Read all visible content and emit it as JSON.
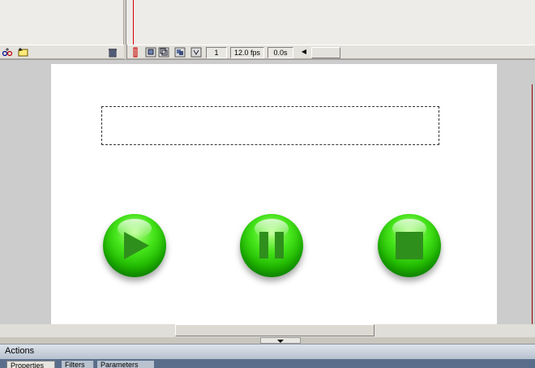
{
  "timeline": {
    "current_frame": "1",
    "frame_rate": "12.0 fps",
    "elapsed_time": "0.0s"
  },
  "stage": {
    "buttons": [
      {
        "name": "play",
        "icon": "play-icon"
      },
      {
        "name": "pause",
        "icon": "pause-icon"
      },
      {
        "name": "stop",
        "icon": "stop-icon"
      }
    ],
    "button_color": "#33cc00",
    "background": "#ffffff"
  },
  "panels": {
    "actions_label": "Actions",
    "tabs": [
      {
        "label": "Properties"
      },
      {
        "label": "Filters"
      },
      {
        "label": "Parameters"
      }
    ]
  }
}
